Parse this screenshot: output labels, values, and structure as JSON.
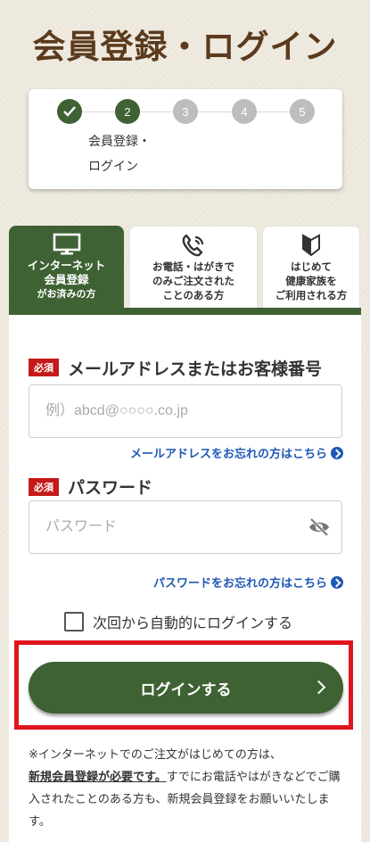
{
  "page": {
    "title": "会員登録・ログイン"
  },
  "steps": {
    "items": [
      {
        "label": "✓",
        "state": "done"
      },
      {
        "label": "2",
        "state": "current"
      },
      {
        "label": "3",
        "state": "todo"
      },
      {
        "label": "4",
        "state": "todo"
      },
      {
        "label": "5",
        "state": "todo"
      }
    ],
    "current_label_line1": "会員登録・",
    "current_label_line2": "ログイン"
  },
  "tabs": {
    "internet": {
      "line1": "インターネット",
      "line2": "会員登録",
      "line3": "がお済みの方",
      "icon": "monitor-icon"
    },
    "phone": {
      "line1": "お電話・はがきで",
      "line2": "のみご注文された",
      "line3": "ことのある方",
      "icon": "phone-icon"
    },
    "first": {
      "line1": "はじめて",
      "line2": "健康家族を",
      "line3": "ご利用される方",
      "icon": "beginner-mark-icon"
    }
  },
  "form": {
    "required_badge": "必須",
    "email": {
      "label": "メールアドレスまたはお客様番号",
      "placeholder": "例）abcd@○○○○.co.jp",
      "value": "",
      "forgot_link": "メールアドレスをお忘れの方はこちら"
    },
    "password": {
      "label": "パスワード",
      "placeholder": "パスワード",
      "value": "",
      "forgot_link": "パスワードをお忘れの方はこちら",
      "toggle_icon": "eye-off-icon"
    },
    "remember": {
      "label": "次回から自動的にログインする",
      "checked": false
    },
    "login_button": "ログインする"
  },
  "note": {
    "before_link": "※インターネットでのご注文がはじめての方は、",
    "link": "新規会員登録が必要です。",
    "after_link": "すでにお電話やはがきなどでご購入されたことのある方も、新規会員登録をお願いいたします。"
  },
  "colors": {
    "brand_green": "#3e6233",
    "required_red": "#c41a1a",
    "link_blue": "#1e58b5",
    "highlight_red": "#e0141f",
    "title_brown": "#5b3a1d"
  }
}
